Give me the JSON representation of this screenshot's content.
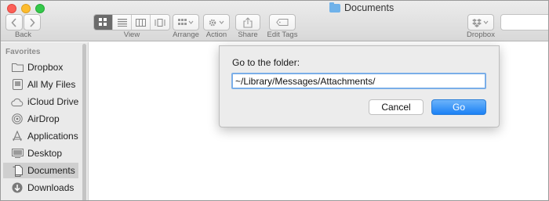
{
  "window": {
    "title": "Documents"
  },
  "toolbar": {
    "back_label": "Back",
    "view_label": "View",
    "arrange_label": "Arrange",
    "action_label": "Action",
    "share_label": "Share",
    "edit_tags_label": "Edit Tags",
    "dropbox_label": "Dropbox"
  },
  "sidebar": {
    "heading": "Favorites",
    "items": [
      {
        "label": "Dropbox",
        "icon": "folder-icon"
      },
      {
        "label": "All My Files",
        "icon": "all-files-icon"
      },
      {
        "label": "iCloud Drive",
        "icon": "cloud-icon"
      },
      {
        "label": "AirDrop",
        "icon": "airdrop-icon"
      },
      {
        "label": "Applications",
        "icon": "applications-icon"
      },
      {
        "label": "Desktop",
        "icon": "desktop-icon"
      },
      {
        "label": "Documents",
        "icon": "documents-icon",
        "selected": true
      },
      {
        "label": "Downloads",
        "icon": "downloads-icon"
      }
    ]
  },
  "dialog": {
    "title": "Go to the folder:",
    "path_value": "~/Library/Messages/Attachments/",
    "cancel_label": "Cancel",
    "go_label": "Go"
  },
  "colors": {
    "accent": "#1b81f5",
    "close": "#fc5f57",
    "minimize": "#fdbc2e",
    "zoom": "#34c84a",
    "sidebar_bg": "#eaeaea",
    "selected_bg": "#cfcfcf"
  }
}
